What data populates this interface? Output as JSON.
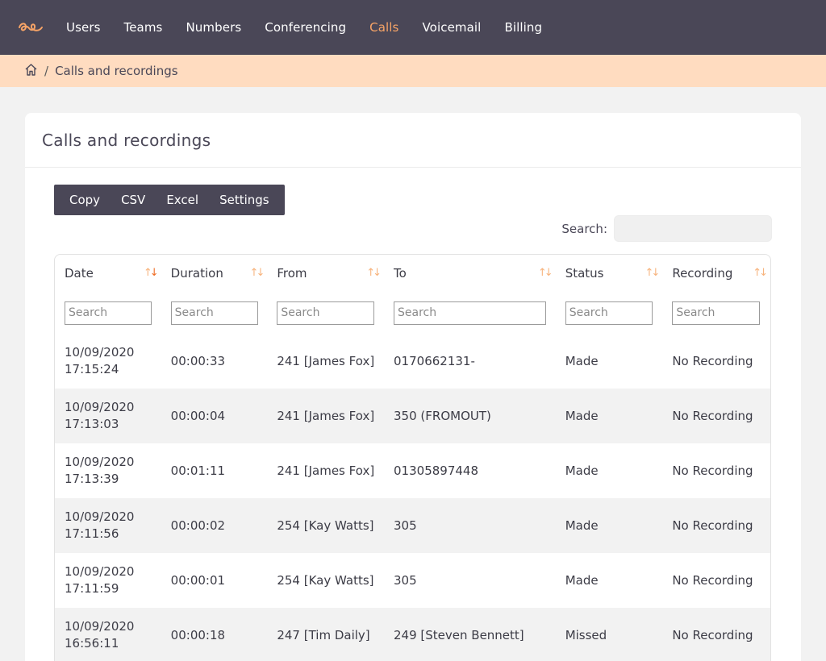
{
  "nav": {
    "logo": "logo-icon",
    "items": [
      {
        "label": "Users"
      },
      {
        "label": "Teams"
      },
      {
        "label": "Numbers"
      },
      {
        "label": "Conferencing"
      },
      {
        "label": "Calls",
        "active": true
      },
      {
        "label": "Voicemail"
      },
      {
        "label": "Billing"
      }
    ],
    "accent_color": "#f7a467"
  },
  "breadcrumb": {
    "home_icon": "home-icon",
    "separator": "/",
    "current": "Calls and recordings"
  },
  "card": {
    "title": "Calls and recordings"
  },
  "toolbar": {
    "copy_label": "Copy",
    "csv_label": "CSV",
    "excel_label": "Excel",
    "settings_label": "Settings"
  },
  "search": {
    "label": "Search:",
    "value": ""
  },
  "table": {
    "columns": [
      {
        "label": "Date",
        "sorted": "desc"
      },
      {
        "label": "Duration"
      },
      {
        "label": "From"
      },
      {
        "label": "To"
      },
      {
        "label": "Status"
      },
      {
        "label": "Recording"
      }
    ],
    "filter_placeholder": "Search",
    "rows": [
      {
        "date": "10/09/2020",
        "time": "17:15:24",
        "duration": "00:00:33",
        "from": "241 [James Fox]",
        "to": "0170662131-",
        "status": "Made",
        "recording": "No Recording"
      },
      {
        "date": "10/09/2020",
        "time": "17:13:03",
        "duration": "00:00:04",
        "from": "241 [James Fox]",
        "to": "350 (FROMOUT)",
        "status": "Made",
        "recording": "No Recording"
      },
      {
        "date": "10/09/2020",
        "time": "17:13:39",
        "duration": "00:01:11",
        "from": "241 [James Fox]",
        "to": "01305897448",
        "status": "Made",
        "recording": "No Recording"
      },
      {
        "date": "10/09/2020",
        "time": "17:11:56",
        "duration": "00:00:02",
        "from": "254 [Kay Watts]",
        "to": "305",
        "status": "Made",
        "recording": "No Recording"
      },
      {
        "date": "10/09/2020",
        "time": "17:11:59",
        "duration": "00:00:01",
        "from": "254 [Kay Watts]",
        "to": "305",
        "status": "Made",
        "recording": "No Recording"
      },
      {
        "date": "10/09/2020",
        "time": "16:56:11",
        "duration": "00:00:18",
        "from": "247 [Tim Daily]",
        "to": "249 [Steven Bennett]",
        "status": "Missed",
        "recording": "No Recording"
      }
    ]
  }
}
